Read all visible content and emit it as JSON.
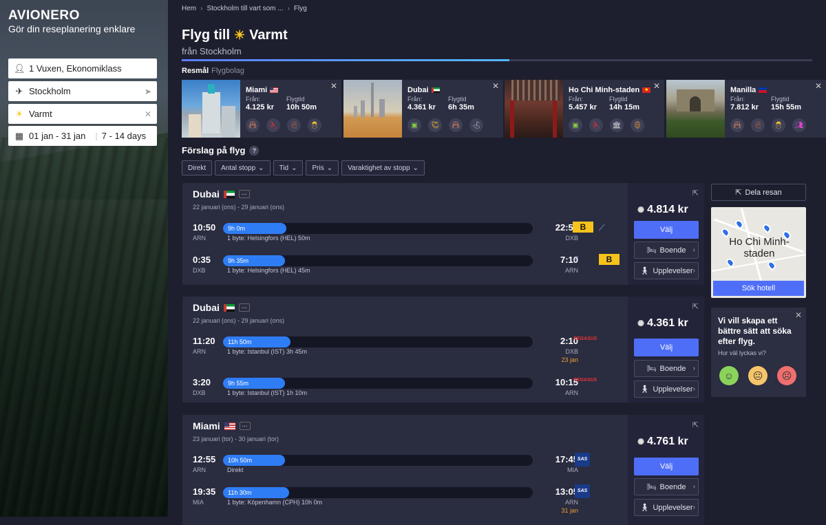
{
  "sidebar": {
    "logo": "AVIONERO",
    "tagline": "Gör din reseplanering enklare",
    "passengers": "1 Vuxen, Ekonomiklass",
    "origin": "Stockholm",
    "destination": "Varmt",
    "dates": "01 jan - 31 jan",
    "duration": "7 - 14 days"
  },
  "breadcrumb": [
    "Hem",
    "Stockholm till vart som ...",
    "Flyg"
  ],
  "header": {
    "title_prefix": "Flyg till",
    "title_dest": "Varmt",
    "subtitle": "från Stockholm",
    "progress": 0.52
  },
  "tabs": {
    "active": "Resmål",
    "inactive": "Flygbolag"
  },
  "destinations": [
    {
      "name": "Miami",
      "from_label": "Från:",
      "from_value": "4.125 kr",
      "time_label": "Flygtid",
      "time_value": "10h 50m"
    },
    {
      "name": "Dubai",
      "from_label": "Från:",
      "from_value": "4.361 kr",
      "time_label": "Flygtid",
      "time_value": "6h 35m"
    },
    {
      "name": "Ho Chi Minh-staden",
      "from_label": "Från:",
      "from_value": "5.457 kr",
      "time_label": "Flygtid",
      "time_value": "14h 15m"
    },
    {
      "name": "Manilla",
      "from_label": "Från:",
      "from_value": "7.812 kr",
      "time_label": "Flygtid",
      "time_value": "15h 55m"
    }
  ],
  "suggestions_title": "Förslag på flyg",
  "filters": [
    "Direkt",
    "Antal stopp",
    "Tid",
    "Pris",
    "Varaktighet av stopp"
  ],
  "cards": [
    {
      "route": "Dubai",
      "dates": "22 januari (ons) - 29 januari (ons)",
      "price": "4.814 kr",
      "legs": [
        {
          "dep": "10:50",
          "dep_code": "ARN",
          "dur": "9h 0m",
          "stops": "1 byte: Helsingfors (HEL) 50m",
          "arr": "22:50",
          "arr_code": "DXB",
          "plus": ""
        },
        {
          "dep": "0:35",
          "dep_code": "DXB",
          "dur": "9h 35m",
          "stops": "1 byte: Helsingfors (HEL) 45m",
          "arr": "7:10",
          "arr_code": "ARN",
          "plus": ""
        }
      ]
    },
    {
      "route": "Dubai",
      "dates": "22 januari (ons) - 29 januari (ons)",
      "price": "4.361 kr",
      "legs": [
        {
          "dep": "11:20",
          "dep_code": "ARN",
          "dur": "11h 50m",
          "stops": "1 byte: Istanbul (IST) 3h 45m",
          "arr": "2:10",
          "arr_code": "DXB",
          "plus": "23 jan"
        },
        {
          "dep": "3:20",
          "dep_code": "DXB",
          "dur": "9h 55m",
          "stops": "1 byte: Istanbul (IST) 1h 10m",
          "arr": "10:15",
          "arr_code": "ARN",
          "plus": ""
        }
      ]
    },
    {
      "route": "Miami",
      "dates": "23 januari (tor) - 30 januari (tor)",
      "price": "4.761 kr",
      "legs": [
        {
          "dep": "12:55",
          "dep_code": "ARN",
          "dur": "10h 50m",
          "stops": "Direkt",
          "arr": "17:45",
          "arr_code": "MIA",
          "plus": ""
        },
        {
          "dep": "19:35",
          "dep_code": "MIA",
          "dur": "11h 30m",
          "stops": "1 byte: Köpenhamn (CPH) 10h 0m",
          "arr": "13:05",
          "arr_code": "ARN",
          "plus": "31 jan"
        }
      ]
    }
  ],
  "buttons": {
    "select": "Välj",
    "stay": "Boende",
    "experiences": "Upplevelser"
  },
  "side": {
    "share": "Dela resan",
    "map_city": "Ho Chi Minh-staden",
    "search_hotel": "Sök hotell",
    "survey_q": "Vi vill skapa ett bättre sätt att söka efter flyg.",
    "survey_s": "Hur väl lyckas vi?"
  },
  "colors": {
    "accent": "#4f6ef7",
    "bar": "#2f7df5",
    "background": "#1e1f2e"
  }
}
